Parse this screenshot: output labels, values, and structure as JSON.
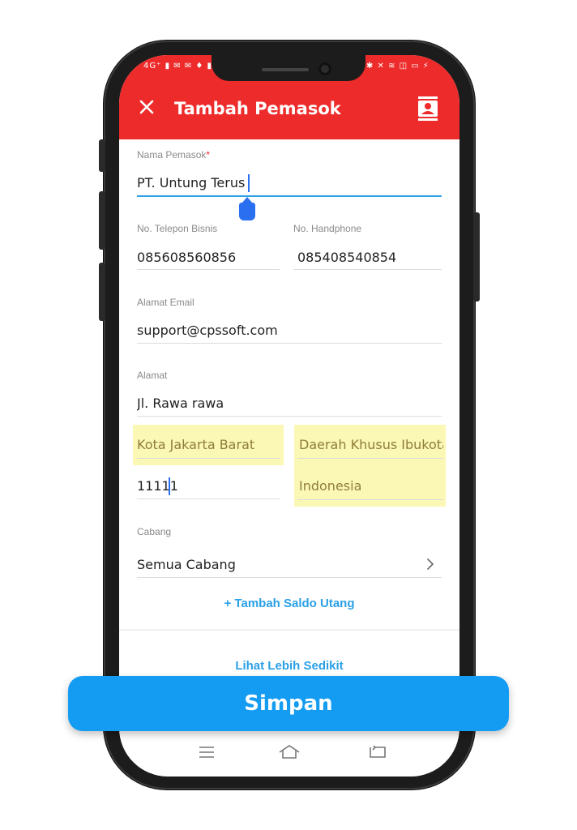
{
  "status_bar": {
    "left": "4G⁺ ▮ ✉ ✉ ♦ ▮",
    "right": "✱ ✕ ≋ ◫ ▭ ⚡"
  },
  "header": {
    "title": "Tambah Pemasok",
    "bg_color": "#ee2b2b"
  },
  "form": {
    "supplier_name": {
      "label": "Nama Pemasok",
      "required_mark": "*",
      "value": "PT. Untung Terus"
    },
    "business_phone": {
      "label": "No. Telepon Bisnis",
      "value": "085608560856"
    },
    "mobile_phone": {
      "label": "No. Handphone",
      "value": "085408540854"
    },
    "email": {
      "label": "Alamat Email",
      "value": "support@cpssoft.com"
    },
    "address": {
      "label": "Alamat",
      "value": "Jl. Rawa rawa"
    },
    "city": {
      "value": "Kota Jakarta Barat"
    },
    "province": {
      "value": "Daerah Khusus Ibukota"
    },
    "postal_code": {
      "value": "11111"
    },
    "country": {
      "value": "Indonesia"
    },
    "branch": {
      "label": "Cabang",
      "value": "Semua Cabang"
    }
  },
  "links": {
    "add_debt_balance": "+ Tambah Saldo Utang",
    "see_less": "Lihat Lebih Sedikit"
  },
  "save_button": {
    "label": "Simpan",
    "color": "#139cf2"
  },
  "icons": {
    "close": "close-icon",
    "contacts": "contact-book-icon",
    "chevron": "chevron-right-icon",
    "nav_menu": "menu-icon",
    "nav_home": "home-icon",
    "nav_back": "back-icon"
  }
}
